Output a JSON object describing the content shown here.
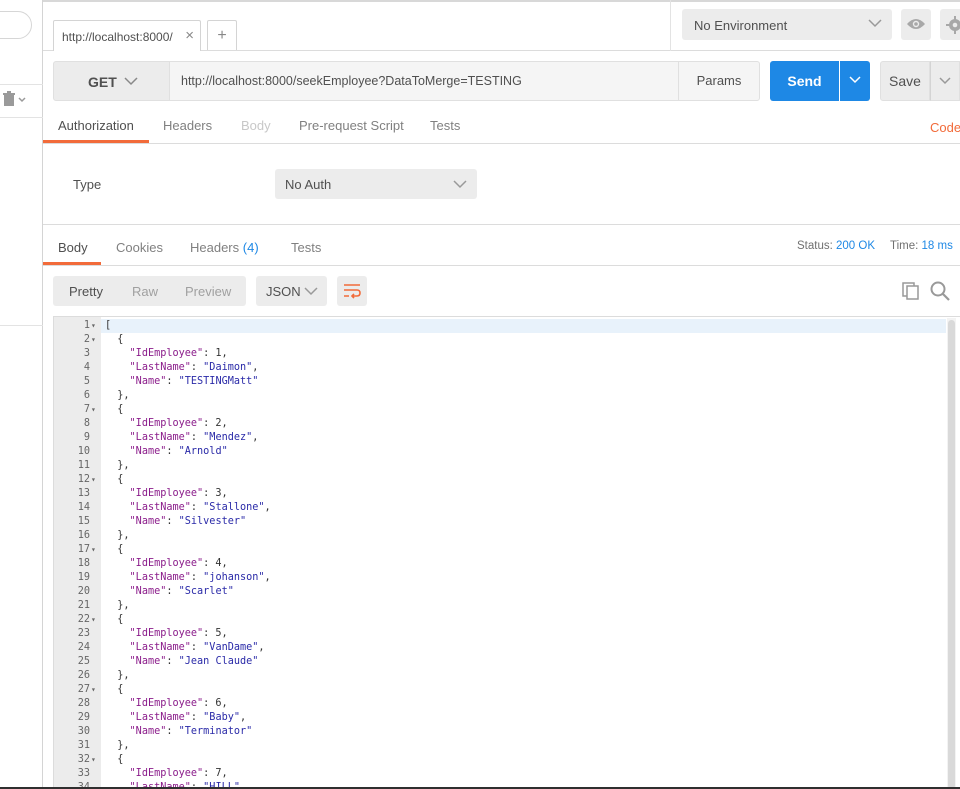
{
  "tab": {
    "label": "http://localhost:8000/",
    "close": "×",
    "new": "+"
  },
  "environment": {
    "selected": "No Environment"
  },
  "request": {
    "method": "GET",
    "url": "http://localhost:8000/seekEmployee?DataToMerge=TESTING",
    "params_label": "Params",
    "send_label": "Send",
    "save_label": "Save"
  },
  "request_tabs": [
    "Authorization",
    "Headers",
    "Body",
    "Pre-request Script",
    "Tests"
  ],
  "code_link": "Code",
  "auth": {
    "type_label": "Type",
    "type_value": "No Auth"
  },
  "response_tabs": {
    "body": "Body",
    "cookies": "Cookies",
    "headers": "Headers",
    "headers_count": "(4)",
    "tests": "Tests"
  },
  "status": {
    "label": "Status:",
    "value": "200 OK"
  },
  "time": {
    "label": "Time:",
    "value": "18 ms"
  },
  "view_modes": [
    "Pretty",
    "Raw",
    "Preview"
  ],
  "format": "JSON",
  "response_lines": [
    "[",
    "  {",
    "    \"IdEmployee\": 1,",
    "    \"LastName\": \"Daimon\",",
    "    \"Name\": \"TESTINGMatt\"",
    "  },",
    "  {",
    "    \"IdEmployee\": 2,",
    "    \"LastName\": \"Mendez\",",
    "    \"Name\": \"Arnold\"",
    "  },",
    "  {",
    "    \"IdEmployee\": 3,",
    "    \"LastName\": \"Stallone\",",
    "    \"Name\": \"Silvester\"",
    "  },",
    "  {",
    "    \"IdEmployee\": 4,",
    "    \"LastName\": \"johanson\",",
    "    \"Name\": \"Scarlet\"",
    "  },",
    "  {",
    "    \"IdEmployee\": 5,",
    "    \"LastName\": \"VanDame\",",
    "    \"Name\": \"Jean Claude\"",
    "  },",
    "  {",
    "    \"IdEmployee\": 6,",
    "    \"LastName\": \"Baby\",",
    "    \"Name\": \"Terminator\"",
    "  },",
    "  {",
    "    \"IdEmployee\": 7,",
    "    \"LastName\": \"HILL\""
  ],
  "foldable_lines": [
    1,
    2,
    7,
    12,
    17,
    22,
    27,
    32
  ],
  "colors": {
    "accent": "#f26b3a",
    "send": "#1e88e5",
    "link": "#1e88e5",
    "json_key": "#8b1c8b",
    "json_string": "#2a2aa8"
  }
}
